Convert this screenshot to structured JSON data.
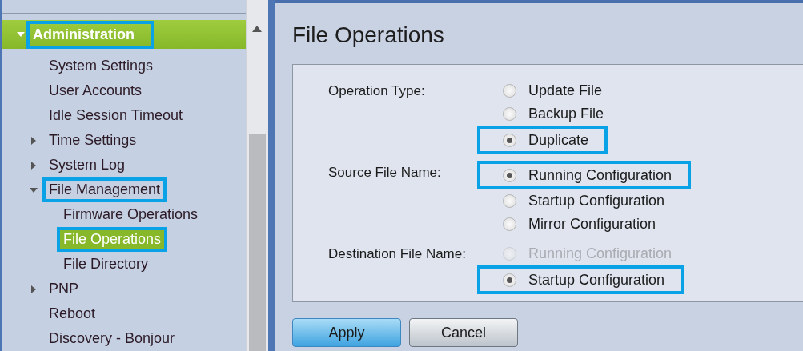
{
  "sidebar": {
    "items": [
      {
        "label": "Administration",
        "kind": "group",
        "expanded": true,
        "selected": false,
        "highlighted": true,
        "children": [
          {
            "label": "System Settings",
            "kind": "page",
            "selected": false,
            "highlighted": false
          },
          {
            "label": "User Accounts",
            "kind": "page",
            "selected": false,
            "highlighted": false
          },
          {
            "label": "Idle Session Timeout",
            "kind": "page",
            "selected": false,
            "highlighted": false
          },
          {
            "label": "Time Settings",
            "kind": "group",
            "expanded": false,
            "selected": false,
            "highlighted": false
          },
          {
            "label": "System Log",
            "kind": "group",
            "expanded": false,
            "selected": false,
            "highlighted": false
          },
          {
            "label": "File Management",
            "kind": "group",
            "expanded": true,
            "selected": false,
            "highlighted": true,
            "children": [
              {
                "label": "Firmware Operations",
                "kind": "page",
                "selected": false,
                "highlighted": false
              },
              {
                "label": "File Operations",
                "kind": "page",
                "selected": true,
                "highlighted": true
              },
              {
                "label": "File Directory",
                "kind": "page",
                "selected": false,
                "highlighted": false
              }
            ]
          },
          {
            "label": "PNP",
            "kind": "group",
            "expanded": false,
            "selected": false,
            "highlighted": false
          },
          {
            "label": "Reboot",
            "kind": "page",
            "selected": false,
            "highlighted": false
          },
          {
            "label": "Discovery - Bonjour",
            "kind": "page",
            "selected": false,
            "highlighted": false
          }
        ]
      }
    ]
  },
  "page": {
    "title": "File Operations",
    "fields": [
      {
        "label": "Operation Type:",
        "options": [
          {
            "label": "Update File",
            "selected": false,
            "disabled": false,
            "highlighted": false
          },
          {
            "label": "Backup File",
            "selected": false,
            "disabled": false,
            "highlighted": false
          },
          {
            "label": "Duplicate",
            "selected": true,
            "disabled": false,
            "highlighted": true
          }
        ]
      },
      {
        "label": "Source File Name:",
        "options": [
          {
            "label": "Running Configuration",
            "selected": true,
            "disabled": false,
            "highlighted": true
          },
          {
            "label": "Startup Configuration",
            "selected": false,
            "disabled": false,
            "highlighted": false
          },
          {
            "label": "Mirror Configuration",
            "selected": false,
            "disabled": false,
            "highlighted": false
          }
        ]
      },
      {
        "label": "Destination File Name:",
        "options": [
          {
            "label": "Running Configuration",
            "selected": false,
            "disabled": true,
            "highlighted": false
          },
          {
            "label": "Startup Configuration",
            "selected": true,
            "disabled": false,
            "highlighted": true
          }
        ]
      }
    ],
    "buttons": [
      {
        "label": "Apply",
        "kind": "primary"
      },
      {
        "label": "Cancel",
        "kind": "secondary"
      }
    ]
  }
}
